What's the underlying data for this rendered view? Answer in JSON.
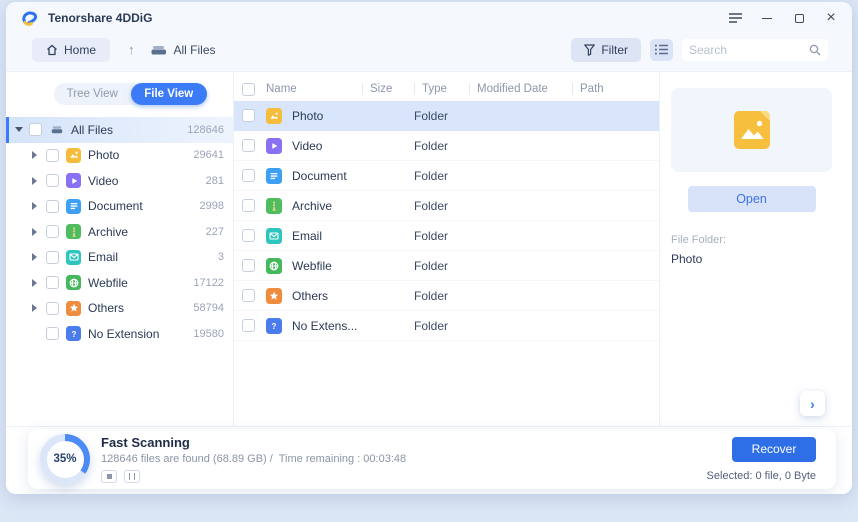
{
  "window": {
    "title": "Tenorshare 4DDiG"
  },
  "toolbar": {
    "home_label": "Home",
    "breadcrumb": "All Files",
    "filter_label": "Filter",
    "search_placeholder": "Search"
  },
  "sidebar": {
    "view_tabs": [
      {
        "label": "Tree View",
        "active": false
      },
      {
        "label": "File View",
        "active": true
      }
    ],
    "tree": [
      {
        "label": "All Files",
        "count": "128646",
        "icon": "drive",
        "root": true,
        "expanded": true,
        "selected": true
      },
      {
        "label": "Photo",
        "count": "29641",
        "icon": "photo",
        "color": "#f6bd3c",
        "arrow": true
      },
      {
        "label": "Video",
        "count": "281",
        "icon": "video",
        "color": "#8a70f2",
        "arrow": true
      },
      {
        "label": "Document",
        "count": "2998",
        "icon": "document",
        "color": "#3da0f5",
        "arrow": true
      },
      {
        "label": "Archive",
        "count": "227",
        "icon": "archive",
        "color": "#4fbd5d",
        "arrow": true
      },
      {
        "label": "Email",
        "count": "3",
        "icon": "email",
        "color": "#2ec5bd",
        "arrow": true
      },
      {
        "label": "Webfile",
        "count": "17122",
        "icon": "webfile",
        "color": "#43b95c",
        "arrow": true
      },
      {
        "label": "Others",
        "count": "58794",
        "icon": "others",
        "color": "#f08c3d",
        "arrow": true
      },
      {
        "label": "No Extension",
        "count": "19580",
        "icon": "noext",
        "color": "#4a7cee",
        "arrow": false
      }
    ]
  },
  "table": {
    "columns": [
      "Name",
      "Size",
      "Type",
      "Modified Date",
      "Path"
    ],
    "rows": [
      {
        "name": "Photo",
        "type": "Folder",
        "icon": "photo",
        "color": "#f6bd3c",
        "selected": true
      },
      {
        "name": "Video",
        "type": "Folder",
        "icon": "video",
        "color": "#8a70f2",
        "selected": false
      },
      {
        "name": "Document",
        "type": "Folder",
        "icon": "document",
        "color": "#3da0f5",
        "selected": false
      },
      {
        "name": "Archive",
        "type": "Folder",
        "icon": "archive",
        "color": "#4fbd5d",
        "selected": false
      },
      {
        "name": "Email",
        "type": "Folder",
        "icon": "email",
        "color": "#2ec5bd",
        "selected": false
      },
      {
        "name": "Webfile",
        "type": "Folder",
        "icon": "webfile",
        "color": "#43b95c",
        "selected": false
      },
      {
        "name": "Others",
        "type": "Folder",
        "icon": "others",
        "color": "#f08c3d",
        "selected": false
      },
      {
        "name": "No Extens...",
        "type": "Folder",
        "icon": "noext",
        "color": "#4a7cee",
        "selected": false
      }
    ]
  },
  "preview": {
    "open_label": "Open",
    "meta_label": "File Folder:",
    "meta_value": "Photo"
  },
  "footer": {
    "progress_percent": "35%",
    "status_title": "Fast Scanning",
    "status_detail": "128646 files are found (68.89 GB) /  Time remaining : 00:03:48",
    "recover_label": "Recover",
    "selected_summary": "Selected: 0 file, 0 Byte"
  },
  "colors": {
    "accent": "#3b7bf6",
    "recover_button": "#2e6fe8",
    "selected_row": "#d8e5fa",
    "photo_yellow": "#f6bd3c"
  }
}
